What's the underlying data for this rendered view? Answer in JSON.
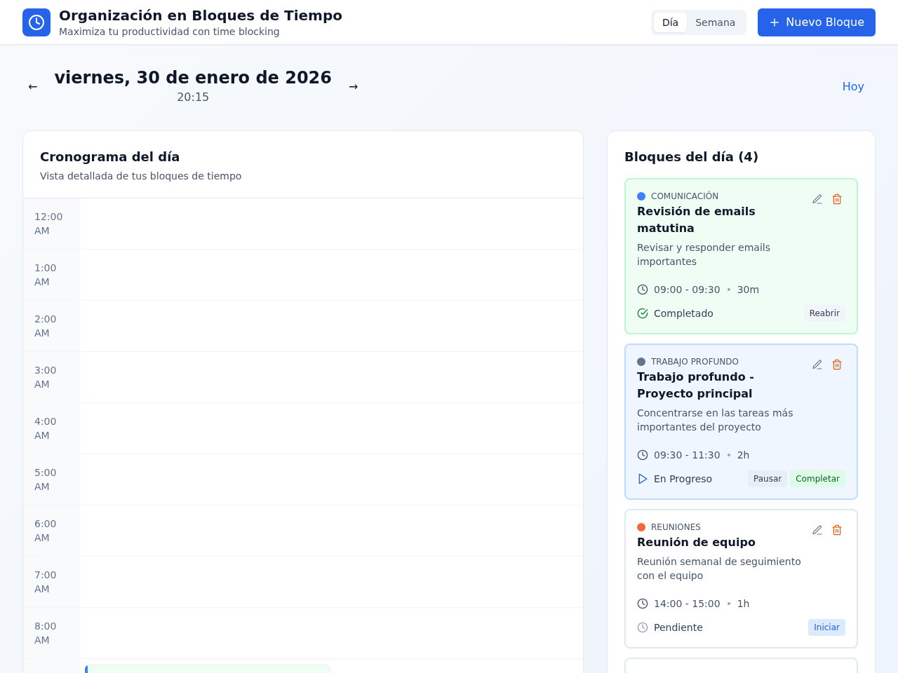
{
  "header": {
    "title": "Organización en Bloques de Tiempo",
    "subtitle": "Maximiza tu productividad con time blocking"
  },
  "view_tabs": [
    {
      "label": "Día",
      "selected": true
    },
    {
      "label": "Semana",
      "selected": false
    }
  ],
  "new_block_button": {
    "label": "Nuevo Bloque"
  },
  "date_nav": {
    "prev": "←",
    "date": "viernes, 30 de enero de 2026",
    "time": "20:15",
    "next": "→",
    "today": "Hoy"
  },
  "timeline": {
    "title": "Cronograma del día",
    "subtitle": "Vista detallada de tus bloques de tiempo",
    "rows": [
      {
        "time": "12:00 AM"
      },
      {
        "time": "1:00 AM"
      },
      {
        "time": "2:00 AM"
      },
      {
        "time": "3:00 AM"
      },
      {
        "time": "4:00 AM"
      },
      {
        "time": "5:00 AM"
      },
      {
        "time": "6:00 AM"
      },
      {
        "time": "7:00 AM"
      },
      {
        "time": "8:00 AM"
      },
      {
        "blocks": [
          {
            "kind": "completed",
            "color": "#3b82f6"
          }
        ]
      }
    ]
  },
  "blocks_panel": {
    "title": "Bloques del día (4)",
    "blocks": [
      {
        "category": "COMUNICACIÓN",
        "color": "#3b82f6",
        "title": "Revisión de emails matutina",
        "description": "Revisar y responder emails importantes",
        "time": "09:00 - 09:30",
        "duration": "30m",
        "kind": "completed",
        "status_label": "Completado",
        "actions": [
          {
            "label": "Reabrir",
            "kind": "reopen"
          }
        ]
      },
      {
        "category": "TRABAJO PROFUNDO",
        "color": "#64748b",
        "title": "Trabajo profundo - Proyecto principal",
        "description": "Concentrarse en las tareas más importantes del proyecto",
        "time": "09:30 - 11:30",
        "duration": "2h",
        "kind": "in_progress",
        "status_label": "En Progreso",
        "actions": [
          {
            "label": "Pausar",
            "kind": "pause"
          },
          {
            "label": "Completar",
            "kind": "complete"
          }
        ]
      },
      {
        "category": "REUNIONES",
        "color": "#f4683a",
        "title": "Reunión de equipo",
        "description": "Reunión semanal de seguimiento con el equipo",
        "time": "14:00 - 15:00",
        "duration": "1h",
        "kind": "pending",
        "status_label": "Pendiente",
        "actions": [
          {
            "label": "Iniciar",
            "kind": "start"
          }
        ]
      },
      {
        "kind": "pending"
      }
    ]
  }
}
